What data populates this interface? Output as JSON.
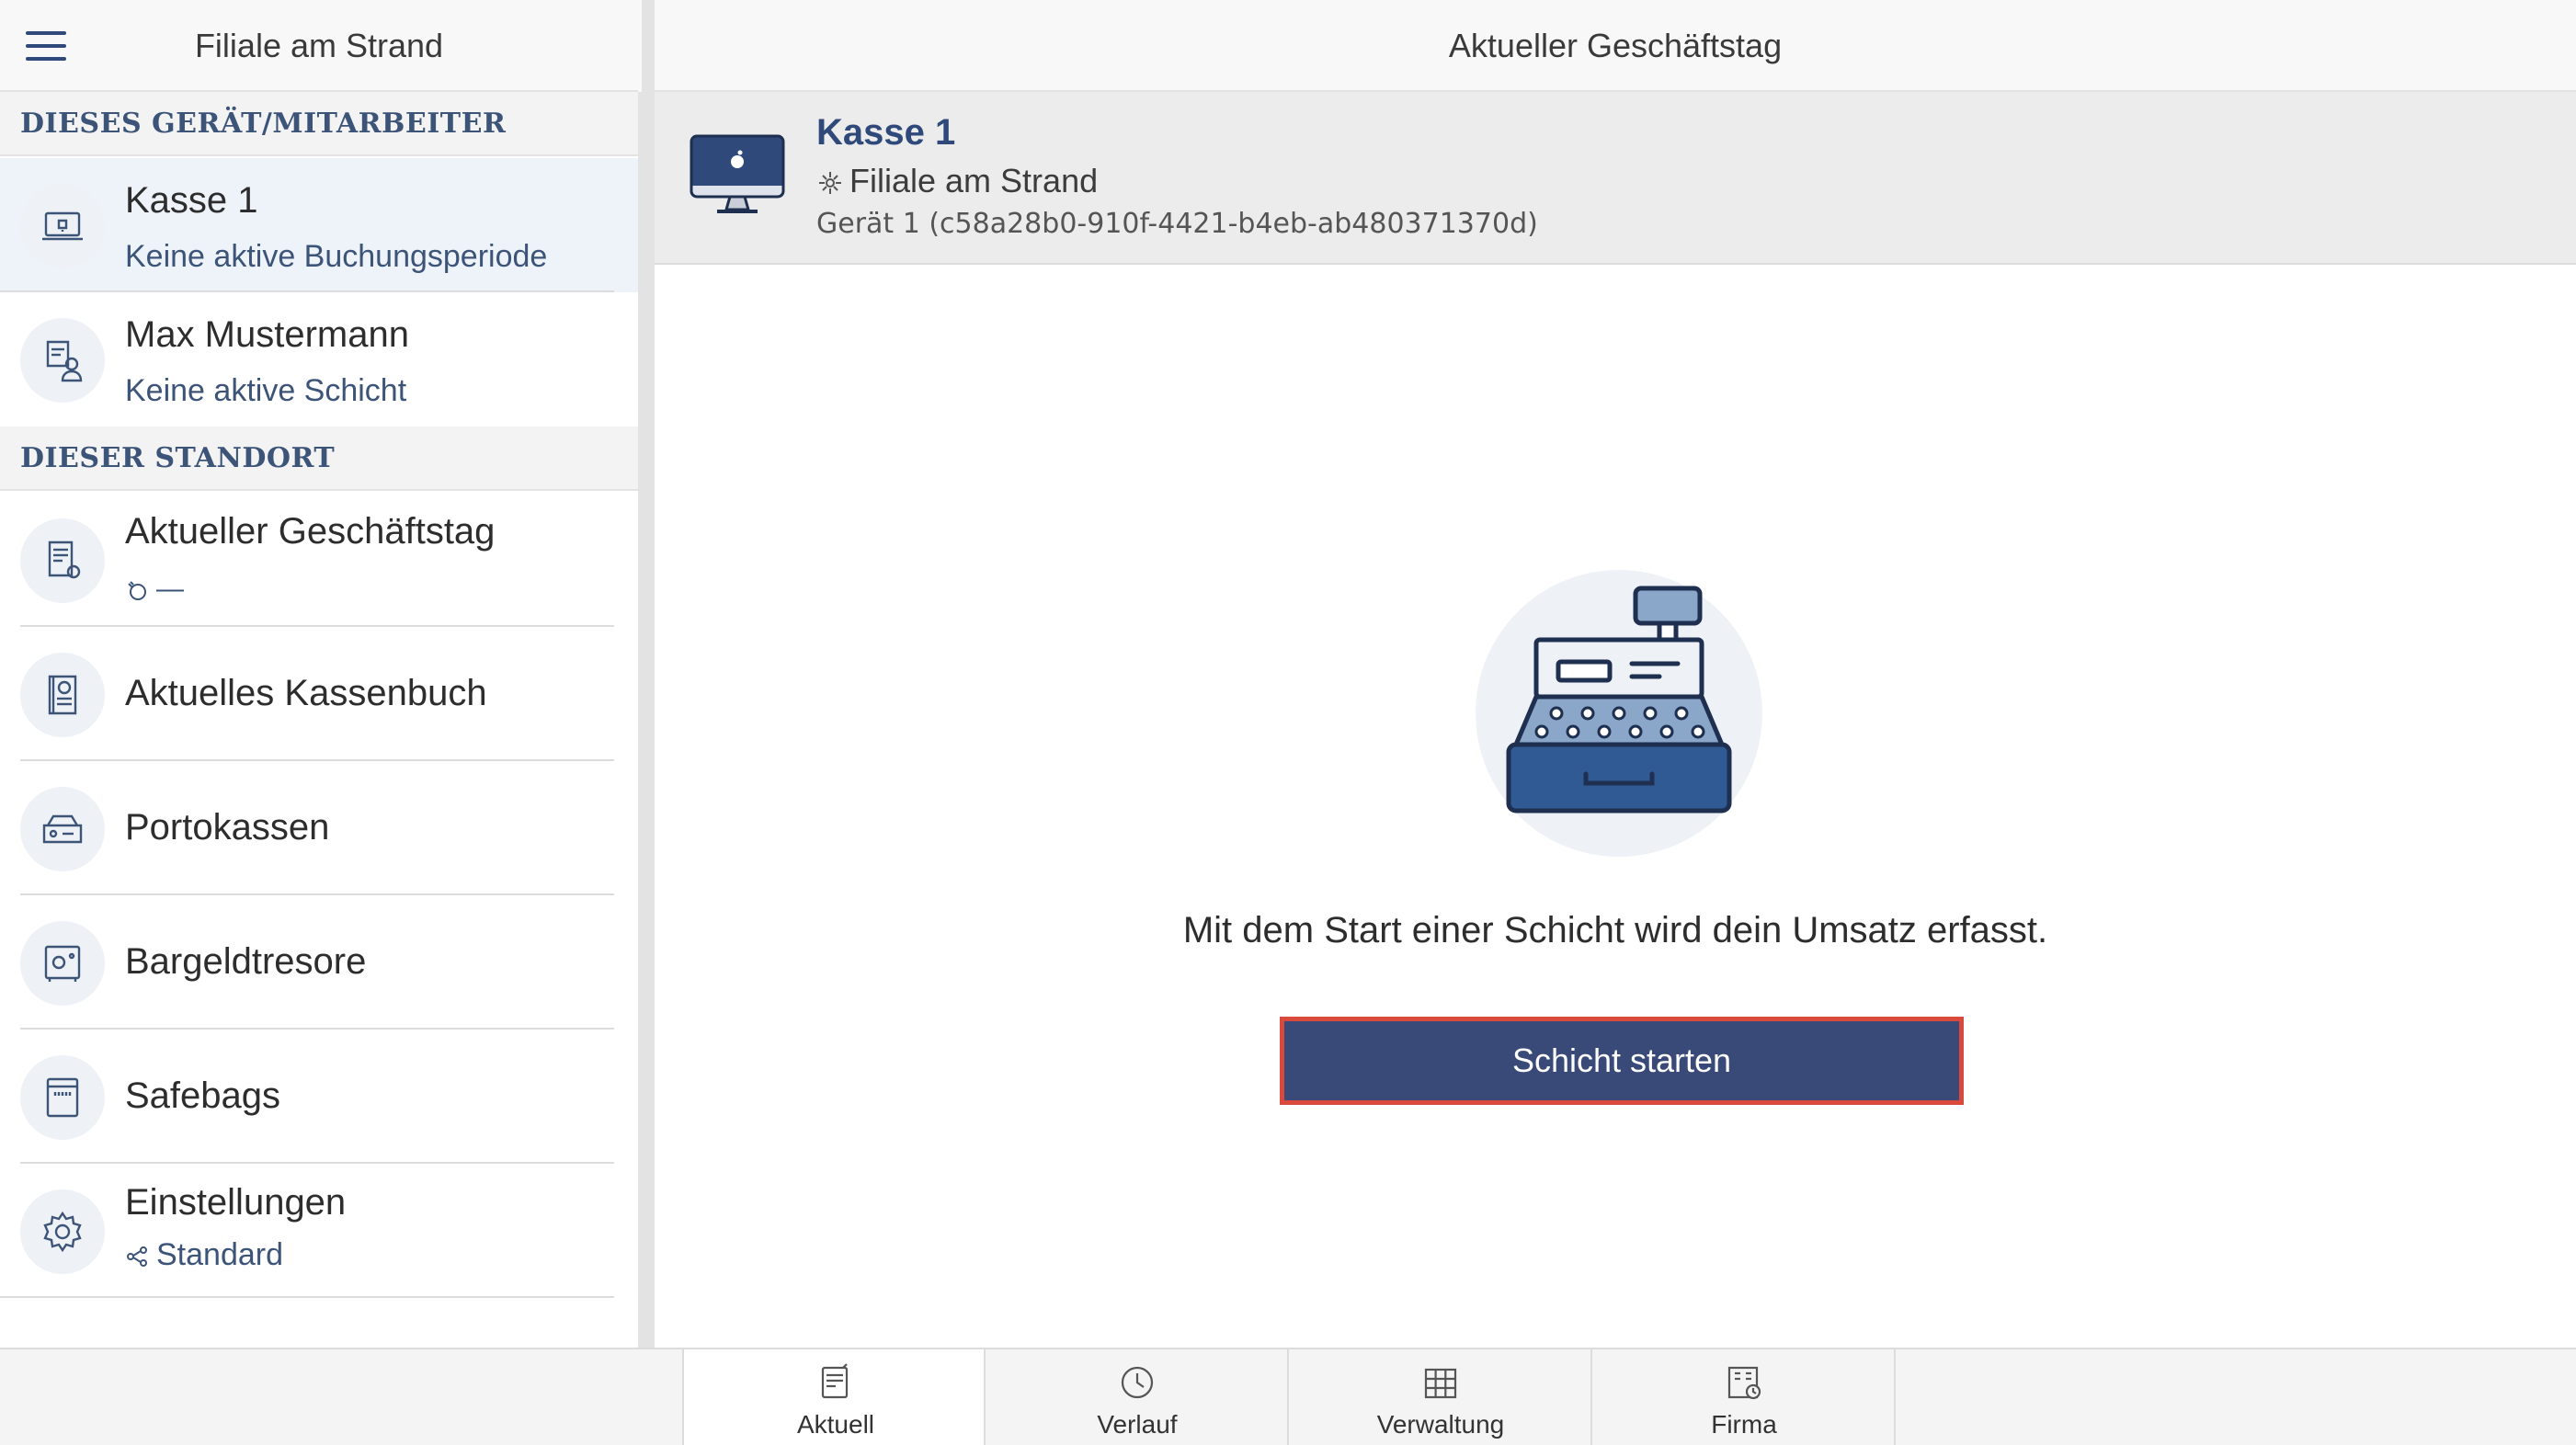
{
  "sidebar": {
    "title": "Filiale am Strand",
    "sections": {
      "device": "DIESES GERÄT/MITARBEITER",
      "location": "DIESER STANDORT"
    },
    "items": [
      {
        "title": "Kasse 1",
        "subtitle": "Keine aktive Buchungsperiode",
        "icon": "pos-terminal-icon"
      },
      {
        "title": "Max Mustermann",
        "subtitle": "Keine aktive Schicht",
        "icon": "employee-icon"
      },
      {
        "title": "Aktueller Geschäftstag",
        "subtitle": "—",
        "icon": "business-day-icon"
      },
      {
        "title": "Aktuelles Kassenbuch",
        "icon": "cashbook-icon"
      },
      {
        "title": "Portokassen",
        "icon": "petty-cash-icon"
      },
      {
        "title": "Bargeldtresore",
        "icon": "safe-icon"
      },
      {
        "title": "Safebags",
        "icon": "safebag-icon"
      },
      {
        "title": "Einstellungen",
        "subtitle": "Standard",
        "icon": "gear-icon"
      }
    ]
  },
  "main": {
    "title": "Aktueller Geschäftstag",
    "device": {
      "name": "Kasse 1",
      "location": "Filiale am Strand",
      "id": "Gerät 1 (c58a28b0-910f-4421-b4eb-ab480371370d)"
    },
    "empty_message": "Mit dem Start einer Schicht wird dein Umsatz erfasst.",
    "start_button": "Schicht starten"
  },
  "tabs": [
    {
      "label": "Aktuell",
      "icon": "document-icon",
      "active": true
    },
    {
      "label": "Verlauf",
      "icon": "clock-icon",
      "active": false
    },
    {
      "label": "Verwaltung",
      "icon": "grid-icon",
      "active": false
    },
    {
      "label": "Firma",
      "icon": "building-icon",
      "active": false
    }
  ],
  "colors": {
    "accent": "#2f4a7a",
    "button": "#3a4a78",
    "button_border": "#d94a3c",
    "selected_row": "#eef3fa"
  }
}
